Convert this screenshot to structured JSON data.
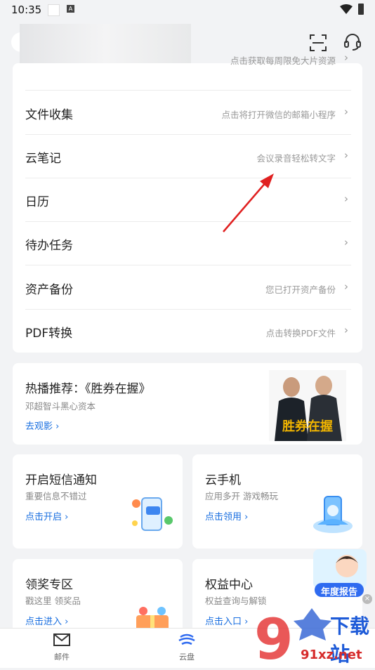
{
  "status": {
    "time": "10:35",
    "a_badge": "A"
  },
  "menu": [
    {
      "label": "",
      "hint": "点击获取每周限免大片资源"
    },
    {
      "label": "文件收集",
      "hint": "点击将打开微信的邮箱小程序"
    },
    {
      "label": "云笔记",
      "hint": "会议录音轻松转文字"
    },
    {
      "label": "日历",
      "hint": ""
    },
    {
      "label": "待办任务",
      "hint": ""
    },
    {
      "label": "资产备份",
      "hint": "您已打开资产备份"
    },
    {
      "label": "PDF转换",
      "hint": "点击转换PDF文件"
    }
  ],
  "promo": {
    "title": "热播推荐：《胜券在握》",
    "subtitle": "邓超智斗黑心资本",
    "link": "去观影",
    "poster_text": "胜券在握"
  },
  "cards": [
    {
      "title": "开启短信通知",
      "subtitle": "重要信息不错过",
      "link": "点击开启"
    },
    {
      "title": "云手机",
      "subtitle": "应用多开 游戏畅玩",
      "link": "点击领用"
    },
    {
      "title": "领奖专区",
      "subtitle": "戳这里 领奖品",
      "link": "点击进入"
    },
    {
      "title": "权益中心",
      "subtitle": "权益查询与解锁",
      "link": "点击入口"
    }
  ],
  "floater": {
    "label": "年度报告"
  },
  "tabs": [
    {
      "label": "邮件"
    },
    {
      "label": "云盘"
    }
  ],
  "watermark": {
    "text": "下载站",
    "url": "91xz.net"
  },
  "colors": {
    "link": "#1a6fe0",
    "arrow": "#e02020",
    "background": "#f2f3f5"
  }
}
